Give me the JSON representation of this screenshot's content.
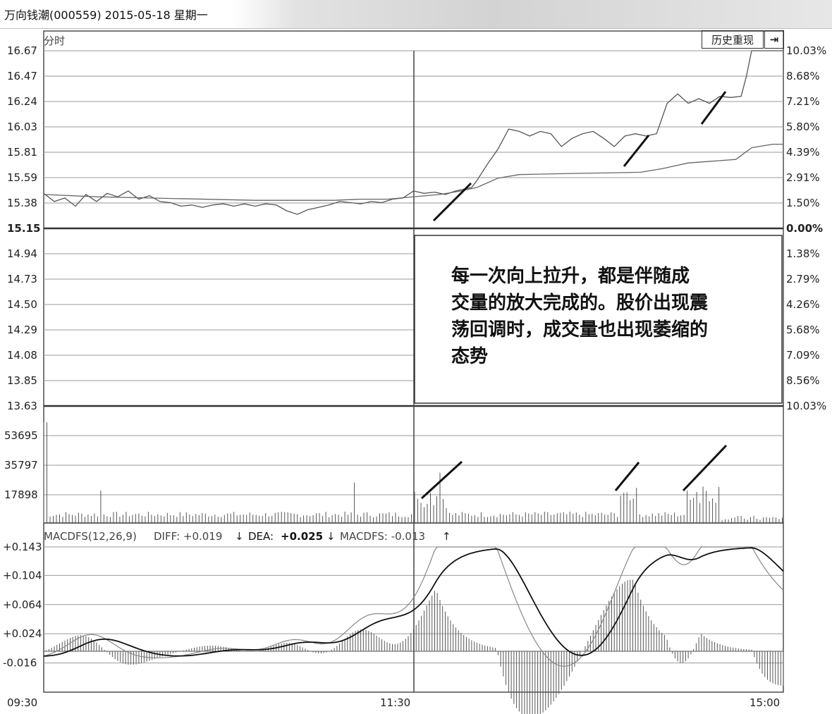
{
  "header": {
    "title": "万向钱潮(000559) 2015-05-18 星期一"
  },
  "toolbar": {
    "history_label": "历史重现",
    "end_icon": "arrow-to-end-icon"
  },
  "chart_data": {
    "type": "line",
    "panel_label": "分时",
    "price_ticks": [
      "16.67",
      "16.47",
      "16.24",
      "16.03",
      "15.81",
      "15.59",
      "15.38",
      "15.15",
      "14.94",
      "14.73",
      "14.50",
      "14.29",
      "14.08",
      "13.85",
      "13.63"
    ],
    "pct_ticks": [
      "10.03%",
      "8.68%",
      "7.21%",
      "5.80%",
      "4.39%",
      "2.91%",
      "1.50%",
      "0.00%",
      "1.38%",
      "2.79%",
      "4.26%",
      "5.68%",
      "7.09%",
      "8.56%",
      "10.03%"
    ],
    "prev_close": 15.15,
    "ylim": [
      13.63,
      16.67
    ],
    "volume_ticks": [
      "53695",
      "35797",
      "17898"
    ],
    "volume_max": 71594,
    "macd": {
      "label": "MACDFS(12,26,9)",
      "diff_label": "DIFF: +0.019",
      "dea_label": "DEA:",
      "dea_value": "+0.025",
      "macdfs_label": "MACDFS: -0.013",
      "ticks": [
        "+0.143",
        "+0.104",
        "+0.064",
        "+0.024",
        "-0.016"
      ],
      "ylim": [
        -0.056,
        0.143
      ]
    },
    "time_ticks": [
      "09:30",
      "11:30",
      "15:00"
    ],
    "annotation": "每一次向上拉升，都是伴随成交量的放大完成的。股价出现震荡回调时，成交量也出现萎缩的态势",
    "price_series": [
      {
        "t": 0,
        "p": 15.45
      },
      {
        "t": 4,
        "p": 15.38
      },
      {
        "t": 8,
        "p": 15.41
      },
      {
        "t": 12,
        "p": 15.34
      },
      {
        "t": 16,
        "p": 15.44
      },
      {
        "t": 20,
        "p": 15.38
      },
      {
        "t": 24,
        "p": 15.45
      },
      {
        "t": 28,
        "p": 15.42
      },
      {
        "t": 32,
        "p": 15.47
      },
      {
        "t": 36,
        "p": 15.4
      },
      {
        "t": 40,
        "p": 15.43
      },
      {
        "t": 44,
        "p": 15.38
      },
      {
        "t": 48,
        "p": 15.37
      },
      {
        "t": 52,
        "p": 15.34
      },
      {
        "t": 56,
        "p": 15.35
      },
      {
        "t": 60,
        "p": 15.33
      },
      {
        "t": 64,
        "p": 15.35
      },
      {
        "t": 68,
        "p": 15.36
      },
      {
        "t": 72,
        "p": 15.34
      },
      {
        "t": 76,
        "p": 15.36
      },
      {
        "t": 80,
        "p": 15.34
      },
      {
        "t": 84,
        "p": 15.36
      },
      {
        "t": 88,
        "p": 15.35
      },
      {
        "t": 92,
        "p": 15.3
      },
      {
        "t": 96,
        "p": 15.27
      },
      {
        "t": 100,
        "p": 15.31
      },
      {
        "t": 104,
        "p": 15.33
      },
      {
        "t": 108,
        "p": 15.35
      },
      {
        "t": 112,
        "p": 15.38
      },
      {
        "t": 116,
        "p": 15.37
      },
      {
        "t": 120,
        "p": 15.36
      },
      {
        "t": 124,
        "p": 15.38
      },
      {
        "t": 128,
        "p": 15.37
      },
      {
        "t": 132,
        "p": 15.4
      },
      {
        "t": 136,
        "p": 15.41
      },
      {
        "t": 140,
        "p": 15.47
      },
      {
        "t": 144,
        "p": 15.45
      },
      {
        "t": 148,
        "p": 15.46
      },
      {
        "t": 152,
        "p": 15.44
      },
      {
        "t": 156,
        "p": 15.47
      },
      {
        "t": 160,
        "p": 15.49
      },
      {
        "t": 162,
        "p": 15.5
      },
      {
        "t": 164,
        "p": 15.56
      },
      {
        "t": 168,
        "p": 15.7
      },
      {
        "t": 172,
        "p": 15.83
      },
      {
        "t": 176,
        "p": 16.0
      },
      {
        "t": 180,
        "p": 15.98
      },
      {
        "t": 184,
        "p": 15.94
      },
      {
        "t": 188,
        "p": 15.98
      },
      {
        "t": 192,
        "p": 15.96
      },
      {
        "t": 196,
        "p": 15.85
      },
      {
        "t": 200,
        "p": 15.92
      },
      {
        "t": 204,
        "p": 15.96
      },
      {
        "t": 208,
        "p": 15.98
      },
      {
        "t": 212,
        "p": 15.92
      },
      {
        "t": 216,
        "p": 15.85
      },
      {
        "t": 220,
        "p": 15.94
      },
      {
        "t": 224,
        "p": 15.96
      },
      {
        "t": 228,
        "p": 15.94
      },
      {
        "t": 232,
        "p": 15.96
      },
      {
        "t": 236,
        "p": 16.22
      },
      {
        "t": 240,
        "p": 16.3
      },
      {
        "t": 244,
        "p": 16.22
      },
      {
        "t": 248,
        "p": 16.26
      },
      {
        "t": 252,
        "p": 16.22
      },
      {
        "t": 256,
        "p": 16.28
      },
      {
        "t": 260,
        "p": 16.27
      },
      {
        "t": 264,
        "p": 16.28
      },
      {
        "t": 266,
        "p": 16.45
      },
      {
        "t": 268,
        "p": 16.67
      },
      {
        "t": 270,
        "p": 16.67
      },
      {
        "t": 280,
        "p": 16.67
      }
    ],
    "avg_series": [
      {
        "t": 0,
        "p": 15.44
      },
      {
        "t": 20,
        "p": 15.42
      },
      {
        "t": 40,
        "p": 15.41
      },
      {
        "t": 80,
        "p": 15.39
      },
      {
        "t": 110,
        "p": 15.39
      },
      {
        "t": 120,
        "p": 15.4
      },
      {
        "t": 130,
        "p": 15.4
      },
      {
        "t": 150,
        "p": 15.44
      },
      {
        "t": 158,
        "p": 15.47
      },
      {
        "t": 164,
        "p": 15.5
      },
      {
        "t": 172,
        "p": 15.58
      },
      {
        "t": 180,
        "p": 15.61
      },
      {
        "t": 200,
        "p": 15.62
      },
      {
        "t": 226,
        "p": 15.63
      },
      {
        "t": 234,
        "p": 15.66
      },
      {
        "t": 244,
        "p": 15.71
      },
      {
        "t": 262,
        "p": 15.74
      },
      {
        "t": 268,
        "p": 15.84
      },
      {
        "t": 276,
        "p": 15.87
      },
      {
        "t": 280,
        "p": 15.87
      }
    ]
  }
}
